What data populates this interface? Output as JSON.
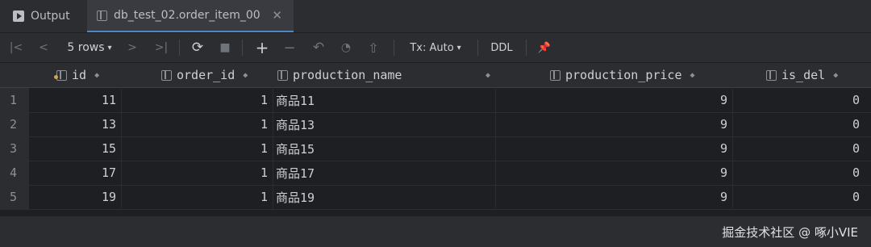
{
  "tabs": [
    {
      "label": "Output",
      "icon": "run-console-icon"
    },
    {
      "label": "db_test_02.order_item_00",
      "icon": "table-icon",
      "close": "✕"
    }
  ],
  "toolbar": {
    "first": "|<",
    "prev": "<",
    "rows": "5 rows",
    "next": ">",
    "last": ">|",
    "refresh": "⟳",
    "stop": "■",
    "add": "+",
    "remove": "−",
    "revert": "↶",
    "preview": "◔",
    "submit": "⇧",
    "tx": "Tx: Auto",
    "ddl": "DDL",
    "pin": "📌"
  },
  "columns": [
    "id",
    "order_id",
    "production_name",
    "production_price",
    "is_del"
  ],
  "rows": [
    {
      "n": "1",
      "id": "11",
      "order_id": "1",
      "production_name": "商品11",
      "production_price": "9",
      "is_del": "0"
    },
    {
      "n": "2",
      "id": "13",
      "order_id": "1",
      "production_name": "商品13",
      "production_price": "9",
      "is_del": "0"
    },
    {
      "n": "3",
      "id": "15",
      "order_id": "1",
      "production_name": "商品15",
      "production_price": "9",
      "is_del": "0"
    },
    {
      "n": "4",
      "id": "17",
      "order_id": "1",
      "production_name": "商品17",
      "production_price": "9",
      "is_del": "0"
    },
    {
      "n": "5",
      "id": "19",
      "order_id": "1",
      "production_name": "商品19",
      "production_price": "9",
      "is_del": "0"
    }
  ],
  "watermark": "掘金技术社区 @ 啄小VIE",
  "colors": {
    "accent": "#4a88c7",
    "background": "#1e1f22",
    "panel": "#2b2d30"
  }
}
